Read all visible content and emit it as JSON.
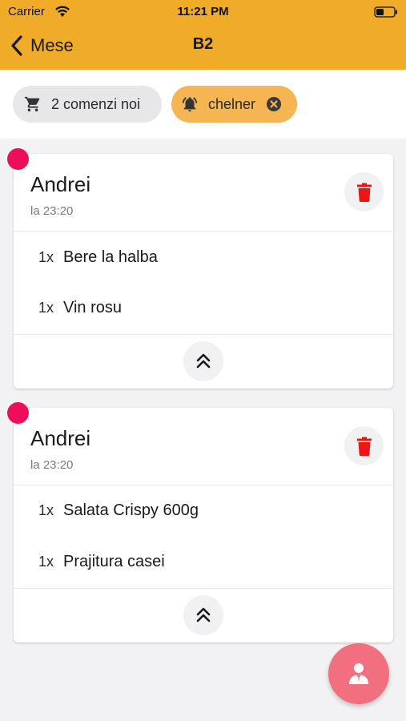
{
  "status_bar": {
    "carrier": "Carrier",
    "time": "11:21 PM"
  },
  "nav": {
    "back_label": "Mese",
    "title": "B2"
  },
  "chips": {
    "orders_label": "2 comenzi noi",
    "waiter_label": "chelner"
  },
  "orders": [
    {
      "customer": "Andrei",
      "time": "la 23:20",
      "items": [
        {
          "qty": "1x",
          "name": "Bere la halba"
        },
        {
          "qty": "1x",
          "name": "Vin rosu"
        }
      ]
    },
    {
      "customer": "Andrei",
      "time": "la 23:20",
      "items": [
        {
          "qty": "1x",
          "name": "Salata Crispy 600g"
        },
        {
          "qty": "1x",
          "name": "Prajitura casei"
        }
      ]
    }
  ],
  "colors": {
    "header": "#f0ab29",
    "chip_waiter": "#f5b553",
    "unread_dot": "#ee0d5a",
    "delete": "#f01414",
    "fab": "#f16f7f"
  },
  "icons": {
    "wifi": "wifi-icon",
    "battery": "battery-icon",
    "back": "chevron-left-icon",
    "cart": "cart-icon",
    "bell": "bell-ring-icon",
    "close": "close-circle-icon",
    "delete": "trash-icon",
    "collapse": "double-chevron-up-icon",
    "fab": "waiter-icon"
  }
}
